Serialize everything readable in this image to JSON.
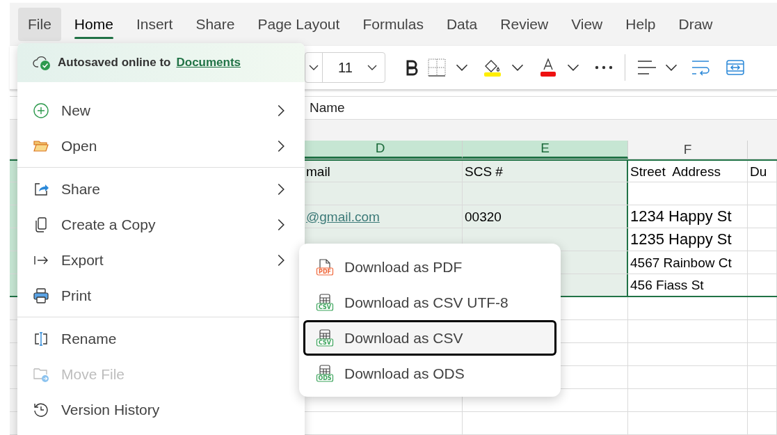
{
  "ribbon_tabs": [
    {
      "label": "File",
      "selected": false,
      "open": true
    },
    {
      "label": "Home",
      "selected": true,
      "open": false
    },
    {
      "label": "Insert",
      "selected": false,
      "open": false
    },
    {
      "label": "Share",
      "selected": false,
      "open": false
    },
    {
      "label": "Page Layout",
      "selected": false,
      "open": false
    },
    {
      "label": "Formulas",
      "selected": false,
      "open": false
    },
    {
      "label": "Data",
      "selected": false,
      "open": false
    },
    {
      "label": "Review",
      "selected": false,
      "open": false
    },
    {
      "label": "View",
      "selected": false,
      "open": false
    },
    {
      "label": "Help",
      "selected": false,
      "open": false
    },
    {
      "label": "Draw",
      "selected": false,
      "open": false
    }
  ],
  "toolbar": {
    "font_size": "11"
  },
  "formula_bar": {
    "text": "Name"
  },
  "sheet": {
    "columns": [
      {
        "label": "D",
        "selected": true
      },
      {
        "label": "E",
        "selected": true
      },
      {
        "label": "F",
        "selected": false
      }
    ],
    "rows": [
      {
        "selected": true,
        "cells": [
          {
            "text": "mail",
            "kind": "text"
          },
          {
            "text": "SCS #",
            "kind": "text"
          },
          {
            "text": "Street  Address",
            "kind": "text"
          },
          {
            "text": "Du",
            "kind": "text"
          }
        ]
      },
      {
        "selected": true,
        "cells": []
      },
      {
        "selected": true,
        "cells": [
          {
            "text": "@gmail.com",
            "kind": "link"
          },
          {
            "text": "00320",
            "kind": "text"
          },
          {
            "text": "1234 Happy St",
            "kind": "large"
          }
        ]
      },
      {
        "selected": true,
        "cells": [
          {
            "kind": "empty"
          },
          {
            "kind": "empty"
          },
          {
            "text": "1235 Happy St",
            "kind": "large"
          }
        ]
      },
      {
        "selected": true,
        "cells": [
          {
            "kind": "empty"
          },
          {
            "kind": "empty"
          },
          {
            "text": "4567 Rainbow Ct",
            "kind": "text"
          }
        ]
      },
      {
        "selected": true,
        "cells": [
          {
            "kind": "empty"
          },
          {
            "kind": "empty"
          },
          {
            "text": "456 Fiass St",
            "kind": "text"
          }
        ]
      },
      {
        "selected": false,
        "cells": []
      },
      {
        "selected": false,
        "cells": []
      },
      {
        "selected": false,
        "cells": []
      },
      {
        "selected": false,
        "cells": []
      },
      {
        "selected": false,
        "cells": []
      },
      {
        "selected": false,
        "cells": []
      }
    ]
  },
  "file_menu": {
    "header": {
      "text": "Autosaved online to",
      "link": "Documents"
    },
    "sections": [
      [
        {
          "label": "New",
          "submenu": true,
          "disabled": false
        },
        {
          "label": "Open",
          "submenu": true,
          "disabled": false
        }
      ],
      [
        {
          "label": "Share",
          "submenu": true,
          "disabled": false
        },
        {
          "label": "Create a Copy",
          "submenu": true,
          "disabled": false
        },
        {
          "label": "Export",
          "submenu": true,
          "disabled": false
        },
        {
          "label": "Print",
          "submenu": false,
          "disabled": false
        }
      ],
      [
        {
          "label": "Rename",
          "submenu": false,
          "disabled": false
        },
        {
          "label": "Move File",
          "submenu": false,
          "disabled": true
        },
        {
          "label": "Version History",
          "submenu": false,
          "disabled": false
        }
      ]
    ]
  },
  "export_menu": [
    {
      "label": "Download as PDF",
      "kind": "pdf",
      "tag": "PDF",
      "selected": false
    },
    {
      "label": "Download as CSV UTF-8",
      "kind": "table",
      "tag": "CSV",
      "selected": false
    },
    {
      "label": "Download as CSV",
      "kind": "table",
      "tag": "CSV",
      "selected": true
    },
    {
      "label": "Download as ODS",
      "kind": "table",
      "tag": "ODS",
      "selected": false
    }
  ]
}
